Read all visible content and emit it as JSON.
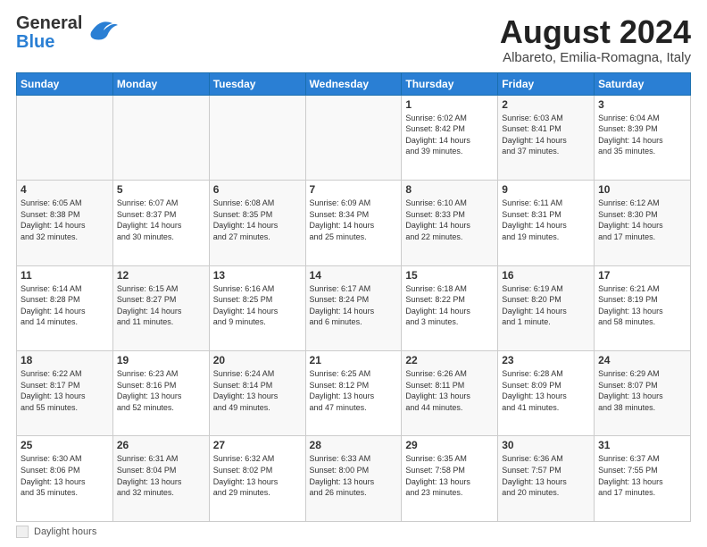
{
  "header": {
    "logo_line1": "General",
    "logo_line2": "Blue",
    "month_title": "August 2024",
    "subtitle": "Albareto, Emilia-Romagna, Italy"
  },
  "days_of_week": [
    "Sunday",
    "Monday",
    "Tuesday",
    "Wednesday",
    "Thursday",
    "Friday",
    "Saturday"
  ],
  "weeks": [
    [
      {
        "day": "",
        "info": "",
        "empty": true
      },
      {
        "day": "",
        "info": "",
        "empty": true
      },
      {
        "day": "",
        "info": "",
        "empty": true
      },
      {
        "day": "",
        "info": "",
        "empty": true
      },
      {
        "day": "1",
        "info": "Sunrise: 6:02 AM\nSunset: 8:42 PM\nDaylight: 14 hours\nand 39 minutes.",
        "empty": false
      },
      {
        "day": "2",
        "info": "Sunrise: 6:03 AM\nSunset: 8:41 PM\nDaylight: 14 hours\nand 37 minutes.",
        "empty": false
      },
      {
        "day": "3",
        "info": "Sunrise: 6:04 AM\nSunset: 8:39 PM\nDaylight: 14 hours\nand 35 minutes.",
        "empty": false
      }
    ],
    [
      {
        "day": "4",
        "info": "Sunrise: 6:05 AM\nSunset: 8:38 PM\nDaylight: 14 hours\nand 32 minutes.",
        "empty": false
      },
      {
        "day": "5",
        "info": "Sunrise: 6:07 AM\nSunset: 8:37 PM\nDaylight: 14 hours\nand 30 minutes.",
        "empty": false
      },
      {
        "day": "6",
        "info": "Sunrise: 6:08 AM\nSunset: 8:35 PM\nDaylight: 14 hours\nand 27 minutes.",
        "empty": false
      },
      {
        "day": "7",
        "info": "Sunrise: 6:09 AM\nSunset: 8:34 PM\nDaylight: 14 hours\nand 25 minutes.",
        "empty": false
      },
      {
        "day": "8",
        "info": "Sunrise: 6:10 AM\nSunset: 8:33 PM\nDaylight: 14 hours\nand 22 minutes.",
        "empty": false
      },
      {
        "day": "9",
        "info": "Sunrise: 6:11 AM\nSunset: 8:31 PM\nDaylight: 14 hours\nand 19 minutes.",
        "empty": false
      },
      {
        "day": "10",
        "info": "Sunrise: 6:12 AM\nSunset: 8:30 PM\nDaylight: 14 hours\nand 17 minutes.",
        "empty": false
      }
    ],
    [
      {
        "day": "11",
        "info": "Sunrise: 6:14 AM\nSunset: 8:28 PM\nDaylight: 14 hours\nand 14 minutes.",
        "empty": false
      },
      {
        "day": "12",
        "info": "Sunrise: 6:15 AM\nSunset: 8:27 PM\nDaylight: 14 hours\nand 11 minutes.",
        "empty": false
      },
      {
        "day": "13",
        "info": "Sunrise: 6:16 AM\nSunset: 8:25 PM\nDaylight: 14 hours\nand 9 minutes.",
        "empty": false
      },
      {
        "day": "14",
        "info": "Sunrise: 6:17 AM\nSunset: 8:24 PM\nDaylight: 14 hours\nand 6 minutes.",
        "empty": false
      },
      {
        "day": "15",
        "info": "Sunrise: 6:18 AM\nSunset: 8:22 PM\nDaylight: 14 hours\nand 3 minutes.",
        "empty": false
      },
      {
        "day": "16",
        "info": "Sunrise: 6:19 AM\nSunset: 8:20 PM\nDaylight: 14 hours\nand 1 minute.",
        "empty": false
      },
      {
        "day": "17",
        "info": "Sunrise: 6:21 AM\nSunset: 8:19 PM\nDaylight: 13 hours\nand 58 minutes.",
        "empty": false
      }
    ],
    [
      {
        "day": "18",
        "info": "Sunrise: 6:22 AM\nSunset: 8:17 PM\nDaylight: 13 hours\nand 55 minutes.",
        "empty": false
      },
      {
        "day": "19",
        "info": "Sunrise: 6:23 AM\nSunset: 8:16 PM\nDaylight: 13 hours\nand 52 minutes.",
        "empty": false
      },
      {
        "day": "20",
        "info": "Sunrise: 6:24 AM\nSunset: 8:14 PM\nDaylight: 13 hours\nand 49 minutes.",
        "empty": false
      },
      {
        "day": "21",
        "info": "Sunrise: 6:25 AM\nSunset: 8:12 PM\nDaylight: 13 hours\nand 47 minutes.",
        "empty": false
      },
      {
        "day": "22",
        "info": "Sunrise: 6:26 AM\nSunset: 8:11 PM\nDaylight: 13 hours\nand 44 minutes.",
        "empty": false
      },
      {
        "day": "23",
        "info": "Sunrise: 6:28 AM\nSunset: 8:09 PM\nDaylight: 13 hours\nand 41 minutes.",
        "empty": false
      },
      {
        "day": "24",
        "info": "Sunrise: 6:29 AM\nSunset: 8:07 PM\nDaylight: 13 hours\nand 38 minutes.",
        "empty": false
      }
    ],
    [
      {
        "day": "25",
        "info": "Sunrise: 6:30 AM\nSunset: 8:06 PM\nDaylight: 13 hours\nand 35 minutes.",
        "empty": false
      },
      {
        "day": "26",
        "info": "Sunrise: 6:31 AM\nSunset: 8:04 PM\nDaylight: 13 hours\nand 32 minutes.",
        "empty": false
      },
      {
        "day": "27",
        "info": "Sunrise: 6:32 AM\nSunset: 8:02 PM\nDaylight: 13 hours\nand 29 minutes.",
        "empty": false
      },
      {
        "day": "28",
        "info": "Sunrise: 6:33 AM\nSunset: 8:00 PM\nDaylight: 13 hours\nand 26 minutes.",
        "empty": false
      },
      {
        "day": "29",
        "info": "Sunrise: 6:35 AM\nSunset: 7:58 PM\nDaylight: 13 hours\nand 23 minutes.",
        "empty": false
      },
      {
        "day": "30",
        "info": "Sunrise: 6:36 AM\nSunset: 7:57 PM\nDaylight: 13 hours\nand 20 minutes.",
        "empty": false
      },
      {
        "day": "31",
        "info": "Sunrise: 6:37 AM\nSunset: 7:55 PM\nDaylight: 13 hours\nand 17 minutes.",
        "empty": false
      }
    ]
  ],
  "footer": {
    "legend_label": "Daylight hours"
  }
}
